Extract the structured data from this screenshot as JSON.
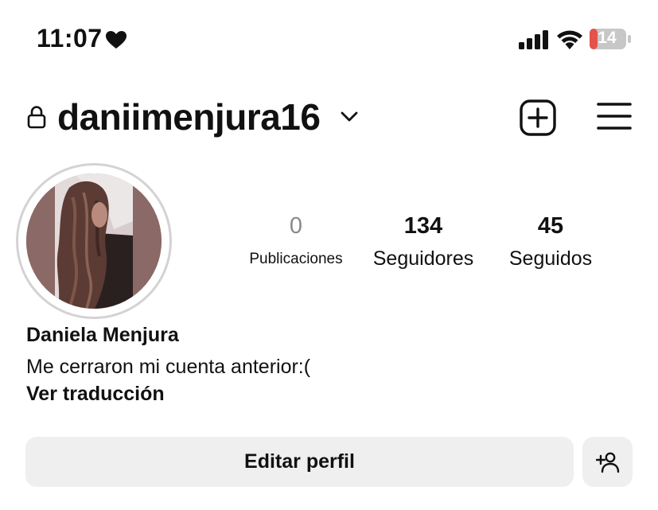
{
  "status_bar": {
    "time": "11:07",
    "battery_level": "14",
    "battery_color": "#e5524c"
  },
  "header": {
    "username": "daniimenjura16"
  },
  "stats": {
    "posts": {
      "count": "0",
      "label": "Publicaciones"
    },
    "followers": {
      "count": "134",
      "label": "Seguidores"
    },
    "following": {
      "count": "45",
      "label": "Seguidos"
    }
  },
  "bio": {
    "full_name": "Daniela Menjura",
    "text": "Me cerraron mi cuenta anterior:(",
    "translate_label": "Ver traducción"
  },
  "actions": {
    "edit_profile_label": "Editar perfil"
  },
  "icons": [
    "heart-icon",
    "signal-icon",
    "wifi-icon",
    "battery-icon",
    "lock-icon",
    "chevron-down-icon",
    "new-post-icon",
    "menu-icon",
    "add-person-icon"
  ]
}
